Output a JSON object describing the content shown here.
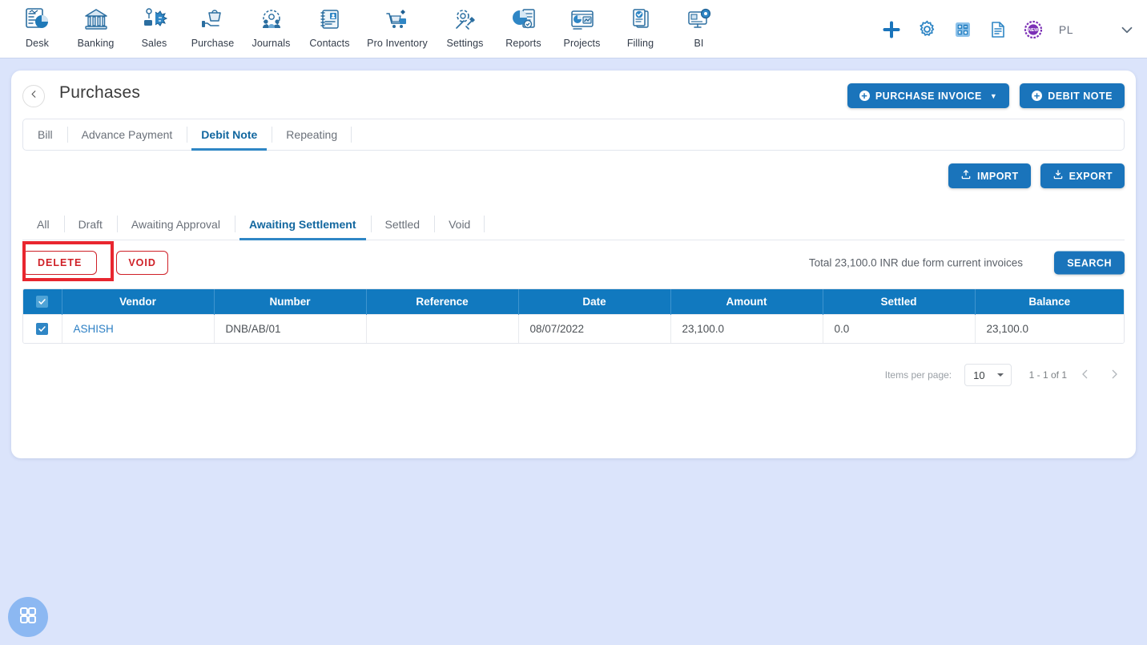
{
  "topnav": {
    "items": [
      {
        "label": "Desk",
        "icon": "dashboard-report-icon"
      },
      {
        "label": "Banking",
        "icon": "bank-building-icon"
      },
      {
        "label": "Sales",
        "icon": "sales-tag-icon"
      },
      {
        "label": "Purchase",
        "icon": "purchase-bag-icon"
      },
      {
        "label": "Journals",
        "icon": "journals-gear-people-icon"
      },
      {
        "label": "Contacts",
        "icon": "contacts-book-icon"
      },
      {
        "label": "Pro Inventory",
        "icon": "inventory-cart-icon"
      },
      {
        "label": "Settings",
        "icon": "settings-gear-wrench-icon"
      },
      {
        "label": "Reports",
        "icon": "reports-piechart-icon"
      },
      {
        "label": "Projects",
        "icon": "projects-board-icon"
      },
      {
        "label": "Filling",
        "icon": "filling-documents-icon"
      },
      {
        "label": "BI",
        "icon": "bi-monitor-icon"
      }
    ],
    "right": {
      "add_icon": "plus-icon",
      "settings_icon": "gear-icon",
      "calculator_icon": "calculator-icon",
      "notes_icon": "notes-document-icon",
      "new_badge_icon": "new-badge-icon",
      "user_initials": "PL",
      "chevron_icon": "chevron-down-icon",
      "accent_blue": "#1a74bb",
      "badge_purple": "#7b2fb5"
    }
  },
  "header": {
    "back_icon": "chevron-left-icon",
    "title": "Purchases",
    "purchase_invoice_label": "PURCHASE INVOICE",
    "debit_note_label": "DEBIT NOTE"
  },
  "doc_tabs": {
    "items": [
      {
        "label": "Bill",
        "active": false
      },
      {
        "label": "Advance Payment",
        "active": false
      },
      {
        "label": "Debit Note",
        "active": true
      },
      {
        "label": "Repeating",
        "active": false
      }
    ]
  },
  "io": {
    "import_label": "IMPORT",
    "import_icon": "upload-icon",
    "export_label": "EXPORT",
    "export_icon": "download-icon"
  },
  "status_tabs": {
    "items": [
      {
        "label": "All",
        "active": false
      },
      {
        "label": "Draft",
        "active": false
      },
      {
        "label": "Awaiting Approval",
        "active": false
      },
      {
        "label": "Awaiting Settlement",
        "active": true
      },
      {
        "label": "Settled",
        "active": false
      },
      {
        "label": "Void",
        "active": false
      }
    ]
  },
  "actions": {
    "delete_label": "DELETE",
    "void_label": "VOID",
    "total_text": "Total 23,100.0 INR due form current invoices",
    "search_label": "SEARCH",
    "highlight_color": "#e8262f",
    "danger_color": "#cf2027"
  },
  "table": {
    "columns": [
      "Vendor",
      "Number",
      "Reference",
      "Date",
      "Amount",
      "Settled",
      "Balance"
    ],
    "header_checkbox_checked": true,
    "rows": [
      {
        "checked": true,
        "vendor": "ASHISH",
        "number": "DNB/AB/01",
        "reference": "",
        "date": "08/07/2022",
        "amount": "23,100.0",
        "settled": "0.0",
        "balance": "23,100.0"
      }
    ],
    "header_blue": "#1179bf"
  },
  "pagination": {
    "items_per_page_label": "Items per page:",
    "items_per_page_value": "10",
    "dropdown_icon": "caret-down-icon",
    "range_text": "1 - 1 of 1",
    "prev_icon": "chevron-left-icon",
    "next_icon": "chevron-right-icon"
  },
  "fab": {
    "icon": "grid-apps-icon",
    "color": "#8cb8f2"
  }
}
